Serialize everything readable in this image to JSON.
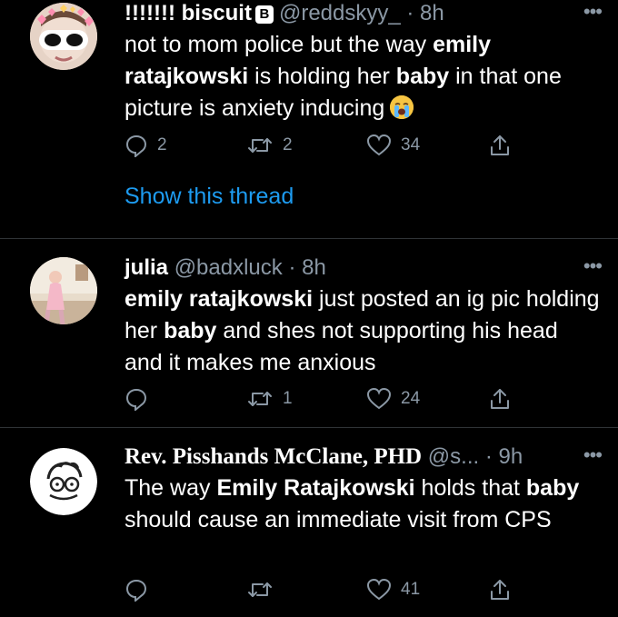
{
  "tweets": [
    {
      "name": "!!!!!!! biscuit",
      "badge": "B",
      "handle": "@reddskyy_",
      "time": "· 8h",
      "more": "•••",
      "body_parts": [
        "not to mom police but the way ",
        "emily ratajkowski",
        " is holding her ",
        "baby",
        " in that one picture is anxiety inducing"
      ],
      "emoji": "loudly-crying-face",
      "reply_count": "2",
      "retweet_count": "2",
      "like_count": "34",
      "show_thread": "Show this thread"
    },
    {
      "name": "julia",
      "handle": "@badxluck",
      "time": "· 8h",
      "more": "•••",
      "body_parts": [
        "emily ratajkowski",
        " just posted an ig pic holding her ",
        "baby",
        " and shes not supporting his head and it makes me anxious"
      ],
      "reply_count": "",
      "retweet_count": "1",
      "like_count": "24"
    },
    {
      "name": "Rev. Pisshands McClane, PHD",
      "handle": "@s...",
      "time": "· 9h",
      "more": "•••",
      "body_parts": [
        "The way ",
        "Emily Ratajkowski",
        " holds that ",
        "baby",
        " should cause an immediate visit from CPS"
      ],
      "reply_count": "",
      "retweet_count": "",
      "like_count": "41"
    }
  ],
  "colors": {
    "link": "#1d9bf0",
    "muted": "#8b98a5",
    "divider": "#2f3336"
  }
}
